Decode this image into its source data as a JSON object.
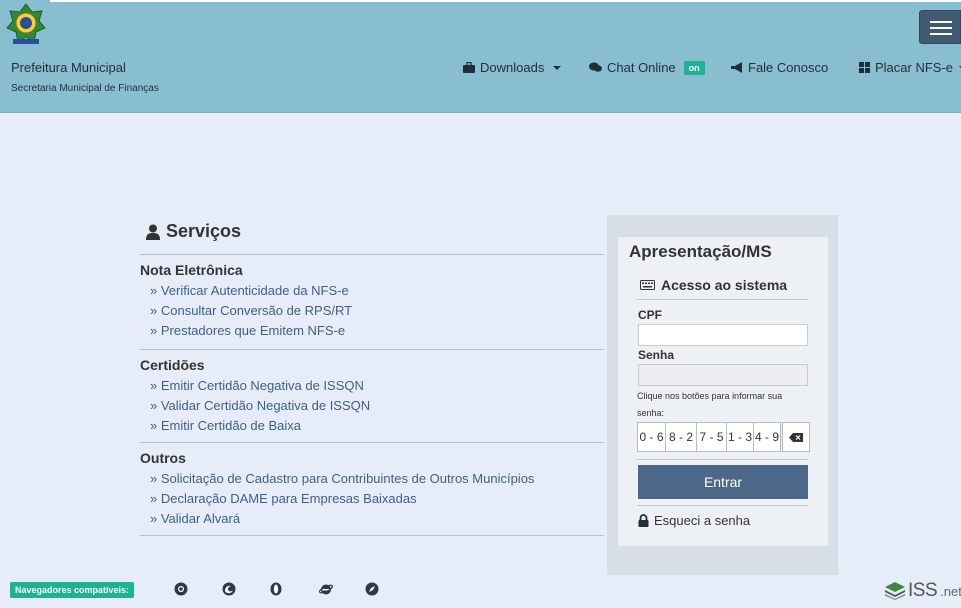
{
  "header": {
    "org_title": "Prefeitura Municipal",
    "org_subtitle": "Secretaria Municipal de Finanças",
    "nav": {
      "downloads": "Downloads",
      "chat": "Chat Online",
      "chat_badge": "on",
      "contact": "Fale Conosco",
      "placar": "Placar NFS-e"
    }
  },
  "services": {
    "title": "Serviços",
    "sections": [
      {
        "heading": "Nota Eletrônica",
        "links": [
          "Verificar Autenticidade da NFS-e",
          "Consultar Conversão de RPS/RT",
          "Prestadores que Emitem NFS-e"
        ]
      },
      {
        "heading": "Certidões",
        "links": [
          "Emitir Certidão Negativa de ISSQN",
          "Validar Certidão Negativa de ISSQN",
          "Emitir Certidão de Baixa"
        ]
      },
      {
        "heading": "Outros",
        "links": [
          "Solicitação de Cadastro para Contribuintes de Outros Municípios",
          "Declaração DAME para Empresas Baixadas",
          "Validar Alvará"
        ]
      }
    ]
  },
  "login": {
    "title": "Apresentação/MS",
    "subtitle": "Acesso ao sistema",
    "cpf_label": "CPF",
    "cpf_value": "",
    "password_label": "Senha",
    "hint": "Clique nos botões para informar sua senha:",
    "keys": [
      "0 - 6",
      "8 - 2",
      "7 - 5",
      "1 - 3",
      "4 - 9"
    ],
    "submit": "Entrar",
    "forgot": "Esqueci a senha"
  },
  "footer": {
    "browsers_label": "Navegadores compatíveis:",
    "logo_text": "ISS",
    "logo_suffix": ".net"
  },
  "colors": {
    "header_bg": "#89bdd0",
    "page_bg": "#e6edf8",
    "accent_green": "#1bb394",
    "primary_button": "#4d6788",
    "link": "#3f5f85"
  }
}
